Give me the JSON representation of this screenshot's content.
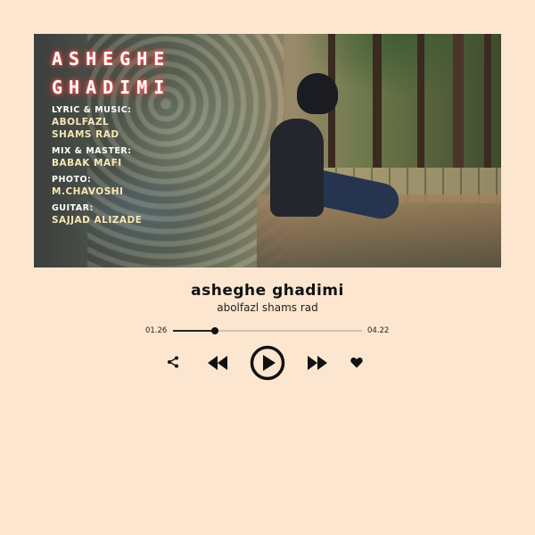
{
  "cover": {
    "title_lines": [
      "ASHEGHE",
      "GHADIMI"
    ],
    "credits": [
      {
        "label": "LYRIC & MUSIC:",
        "values": [
          "ABOLFAZL",
          "SHAMS RAD"
        ]
      },
      {
        "label": "MIX & MASTER:",
        "values": [
          "BABAK MAFI"
        ]
      },
      {
        "label": "PHOTO:",
        "values": [
          "M.CHAVOSHI"
        ]
      },
      {
        "label": "GUITAR:",
        "values": [
          "SAJJAD ALIZADE"
        ]
      }
    ]
  },
  "track": {
    "title": "asheghe ghadimi",
    "artist": "abolfazl shams rad"
  },
  "player": {
    "current_time": "01.26",
    "total_time": "04.22",
    "progress": 0.22,
    "colors": {
      "accent": "#111111",
      "track": "#cfc3b5",
      "background": "#fde6cf"
    }
  },
  "icons": [
    "share-icon",
    "previous-icon",
    "play-icon",
    "next-icon",
    "heart-icon"
  ]
}
